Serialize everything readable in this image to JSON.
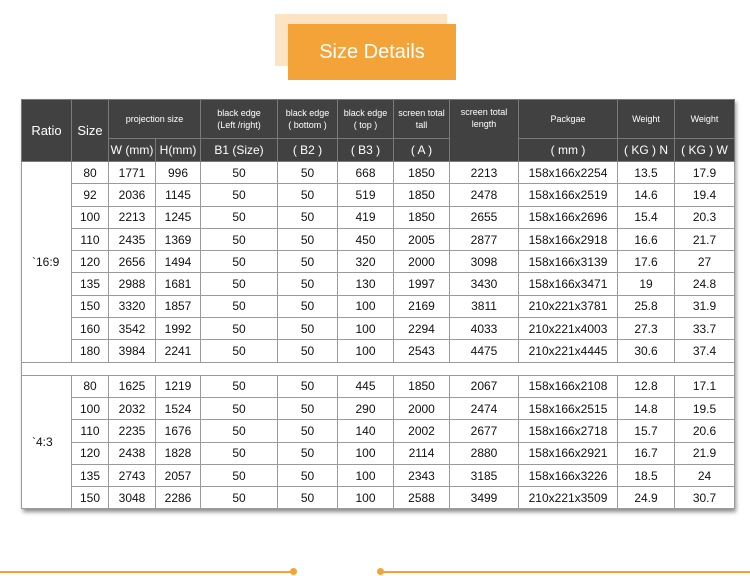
{
  "title": "Size Details",
  "header_top": {
    "ratio": "Ratio",
    "size": "Size",
    "projection_size": "projection size",
    "black_edge_lr_line1": "black edge",
    "black_edge_lr_line2": "(Left /right)",
    "black_edge_bottom_line1": "black edge",
    "black_edge_bottom_line2": "( bottom )",
    "black_edge_top_line1": "black edge",
    "black_edge_top_line2": "( top )",
    "screen_tall_line1": "screen total",
    "screen_tall_line2": "tall",
    "screen_length_line1": "screen total",
    "screen_length_line2": "length",
    "package": "Packgae",
    "weight_n": "Weight",
    "weight_w": "Weight"
  },
  "header_sub": {
    "w": "W (mm)",
    "h": "H(mm)",
    "b1": "B1 (Size)",
    "b2": "( B2 )",
    "b3": "( B3 )",
    "a": "( A )",
    "mm": "( mm )",
    "kg_n": "( KG ) N",
    "kg_w": "( KG ) W"
  },
  "groups": [
    {
      "ratio": "`16:9",
      "rows": [
        [
          "80",
          "1771",
          "996",
          "50",
          "50",
          "668",
          "1850",
          "2213",
          "158x166x2254",
          "13.5",
          "17.9"
        ],
        [
          "92",
          "2036",
          "1145",
          "50",
          "50",
          "519",
          "1850",
          "2478",
          "158x166x2519",
          "14.6",
          "19.4"
        ],
        [
          "100",
          "2213",
          "1245",
          "50",
          "50",
          "419",
          "1850",
          "2655",
          "158x166x2696",
          "15.4",
          "20.3"
        ],
        [
          "110",
          "2435",
          "1369",
          "50",
          "50",
          "450",
          "2005",
          "2877",
          "158x166x2918",
          "16.6",
          "21.7"
        ],
        [
          "120",
          "2656",
          "1494",
          "50",
          "50",
          "320",
          "2000",
          "3098",
          "158x166x3139",
          "17.6",
          "27"
        ],
        [
          "135",
          "2988",
          "1681",
          "50",
          "50",
          "130",
          "1997",
          "3430",
          "158x166x3471",
          "19",
          "24.8"
        ],
        [
          "150",
          "3320",
          "1857",
          "50",
          "50",
          "100",
          "2169",
          "3811",
          "210x221x3781",
          "25.8",
          "31.9"
        ],
        [
          "160",
          "3542",
          "1992",
          "50",
          "50",
          "100",
          "2294",
          "4033",
          "210x221x4003",
          "27.3",
          "33.7"
        ],
        [
          "180",
          "3984",
          "2241",
          "50",
          "50",
          "100",
          "2543",
          "4475",
          "210x221x4445",
          "30.6",
          "37.4"
        ]
      ]
    },
    {
      "ratio": "`4:3",
      "rows": [
        [
          "80",
          "1625",
          "1219",
          "50",
          "50",
          "445",
          "1850",
          "2067",
          "158x166x2108",
          "12.8",
          "17.1"
        ],
        [
          "100",
          "2032",
          "1524",
          "50",
          "50",
          "290",
          "2000",
          "2474",
          "158x166x2515",
          "14.8",
          "19.5"
        ],
        [
          "110",
          "2235",
          "1676",
          "50",
          "50",
          "140",
          "2002",
          "2677",
          "158x166x2718",
          "15.7",
          "20.6"
        ],
        [
          "120",
          "2438",
          "1828",
          "50",
          "50",
          "100",
          "2114",
          "2880",
          "158x166x2921",
          "16.7",
          "21.9"
        ],
        [
          "135",
          "2743",
          "2057",
          "50",
          "50",
          "100",
          "2343",
          "3185",
          "158x166x3226",
          "18.5",
          "24"
        ],
        [
          "150",
          "3048",
          "2286",
          "50",
          "50",
          "100",
          "2588",
          "3499",
          "210x221x3509",
          "24.9",
          "30.7"
        ]
      ]
    }
  ],
  "colors": {
    "accent": "#f4a338",
    "accent_light": "#fbe3c4",
    "header_bg": "#414141"
  }
}
